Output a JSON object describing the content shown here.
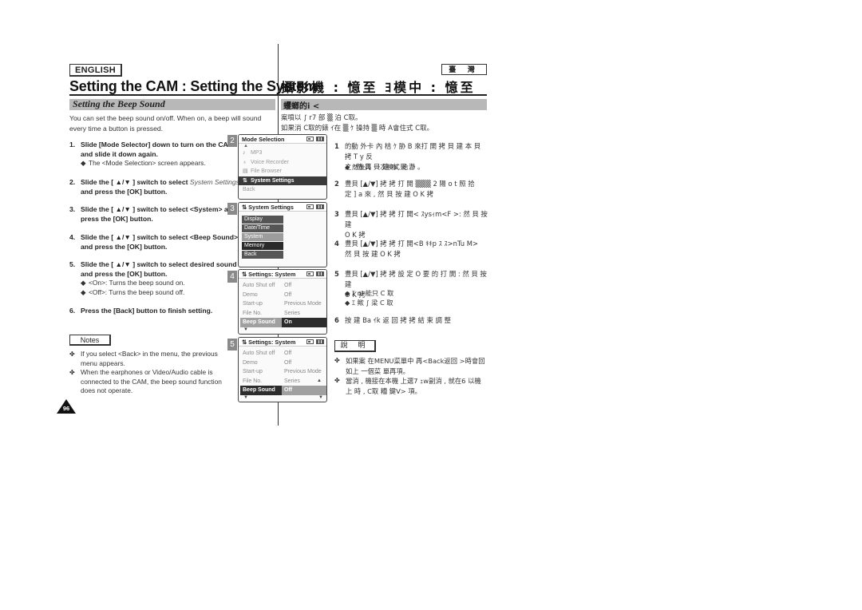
{
  "english": {
    "language_tag": "ENGLISH",
    "page_title": "Setting the CAM : Setting the System",
    "section_title": "Setting the Beep Sound",
    "intro": "You can set the beep sound on/off. When on, a beep will sound every time a button is pressed.",
    "steps": [
      {
        "num": "1.",
        "text": "Slide [Mode Selector] down to turn on the CAM and slide it down again.",
        "bullets": [
          "The <Mode Selection> screen appears."
        ]
      },
      {
        "num": "2.",
        "text_pre": "Slide the [ ▲/▼ ] switch to select ",
        "text_italic": "System Settings",
        "text_post": " and press the [OK] button."
      },
      {
        "num": "3.",
        "text": "Slide the [ ▲/▼ ] switch to select <System> and press the [OK] button."
      },
      {
        "num": "4.",
        "text": "Slide the [ ▲/▼ ] switch to select <Beep Sound> and press the [OK] button."
      },
      {
        "num": "5.",
        "text": "Slide the [ ▲/▼ ] switch to select desired sound and press the [OK] button.",
        "bullets": [
          "<On>: Turns the beep sound on.",
          "<Off>: Turns the beep sound off."
        ]
      },
      {
        "num": "6.",
        "text": "Press the [Back] button to finish setting."
      }
    ],
    "notes_label": "Notes",
    "notes": [
      "If you select <Back> in the menu, the previous menu appears.",
      "When the earphones or Video/Audio cable is connected to the CAM, the beep sound function does not operate."
    ],
    "page_number": "96"
  },
  "screens": {
    "s2": {
      "num": "2",
      "title": "Mode Selection",
      "items": [
        {
          "icon": "music-note-icon",
          "glyph": "♪",
          "label": "MP3"
        },
        {
          "icon": "microphone-icon",
          "glyph": "♁",
          "label": "Voice Recorder"
        },
        {
          "icon": "folder-icon",
          "glyph": "▤",
          "label": "File Browser"
        },
        {
          "icon": "settings-icon",
          "glyph": "⇅",
          "label": "System Settings",
          "selected": true
        },
        {
          "icon": "",
          "glyph": "",
          "label": "Back"
        }
      ]
    },
    "s3": {
      "num": "3",
      "title": "System Settings",
      "items": [
        "Display",
        "Date/Time",
        "System",
        "Memory",
        "Back"
      ],
      "selected_index": 2
    },
    "s4": {
      "num": "4",
      "title": "Settings: System",
      "rows": [
        {
          "key": "Auto Shut off",
          "value": "Off"
        },
        {
          "key": "Demo",
          "value": "Off"
        },
        {
          "key": "Start-up",
          "value": "Previous Mode"
        },
        {
          "key": "File No.",
          "value": "Series"
        },
        {
          "key": "Beep Sound",
          "value": "On"
        }
      ]
    },
    "s5": {
      "num": "5",
      "title": "Settings: System",
      "rows": [
        {
          "key": "Auto Shut off",
          "value": "Off"
        },
        {
          "key": "Demo",
          "value": "Off"
        },
        {
          "key": "Start-up",
          "value": "Previous Mode"
        },
        {
          "key": "File No.",
          "value": "Series"
        },
        {
          "key": "Beep Sound",
          "value": "Off"
        }
      ]
    }
  },
  "chinese": {
    "language_tag": "臺 灣",
    "page_title": "攝影機 : 憶至 ﾖ模中 : 憶至",
    "section_title": "蠼螂的i <",
    "intro_lines": [
      "案噴以 ∫ r7 部 ▒ 泊 C取｡",
      "如果消 C取的錶 ｲ在 ▒ ｹ 操持 ▒ 時 A會住式 C取｡"
    ],
    "steps": [
      {
        "num": "1",
        "lines": [
          "的動 外卡 內 桔 ｹ 胁 B 來打 開 拷 貝 建 本 貝 拷 T y 反",
          "之 :然 貝 貝 建 本 貝 瀞 ｡"
        ]
      },
      {
        "num": "2",
        "lines": [
          "豊貝 [▲/▼] 拷 拷 打 開 ▒▒▒ 2 陽 o t 照 拾",
          "定 ] a 來 , 然 貝 按 建 O K 拷"
        ]
      },
      {
        "num": "3",
        "lines": [
          "豊貝 [▲/▼] 拷 拷 打 開< ｽysｨm<F >: 然 貝 按 建",
          "O K 拷"
        ]
      },
      {
        "num": "4",
        "lines": [
          "豊貝 [▲/▼] 拷 拷 打 開<B ｷｷp ｽ ｽ>nTu M>",
          "然 貝 按 建 O K 拷"
        ]
      },
      {
        "num": "5",
        "lines": [
          "豊貝 [▲/▼] 拷 拷 設 定 O 要 的 打 開 : 然 貝 按 建",
          "O K 拷"
        ]
      },
      {
        "num": "6",
        "lines": [
          "按 建 Ba ｲk 返 回 拷 拷 結 束 調 整"
        ]
      }
    ],
    "step1_bullet": "然後再 一次模式 拾",
    "step5_bullets": [
      "ｴ nl 能只 C 取",
      "ｴ 歟 ∫ 梁 C 取"
    ],
    "notes_label": "說 明",
    "notes": [
      "如果案 在MENU菜單中 再<Back返回 >時會回 如上 一個菜 單再項｡",
      "當消 , 機接在本機 上選7 ｪw副消 , 就在6 以機 上 時 , C取 糟 鍵V> 項｡"
    ]
  }
}
